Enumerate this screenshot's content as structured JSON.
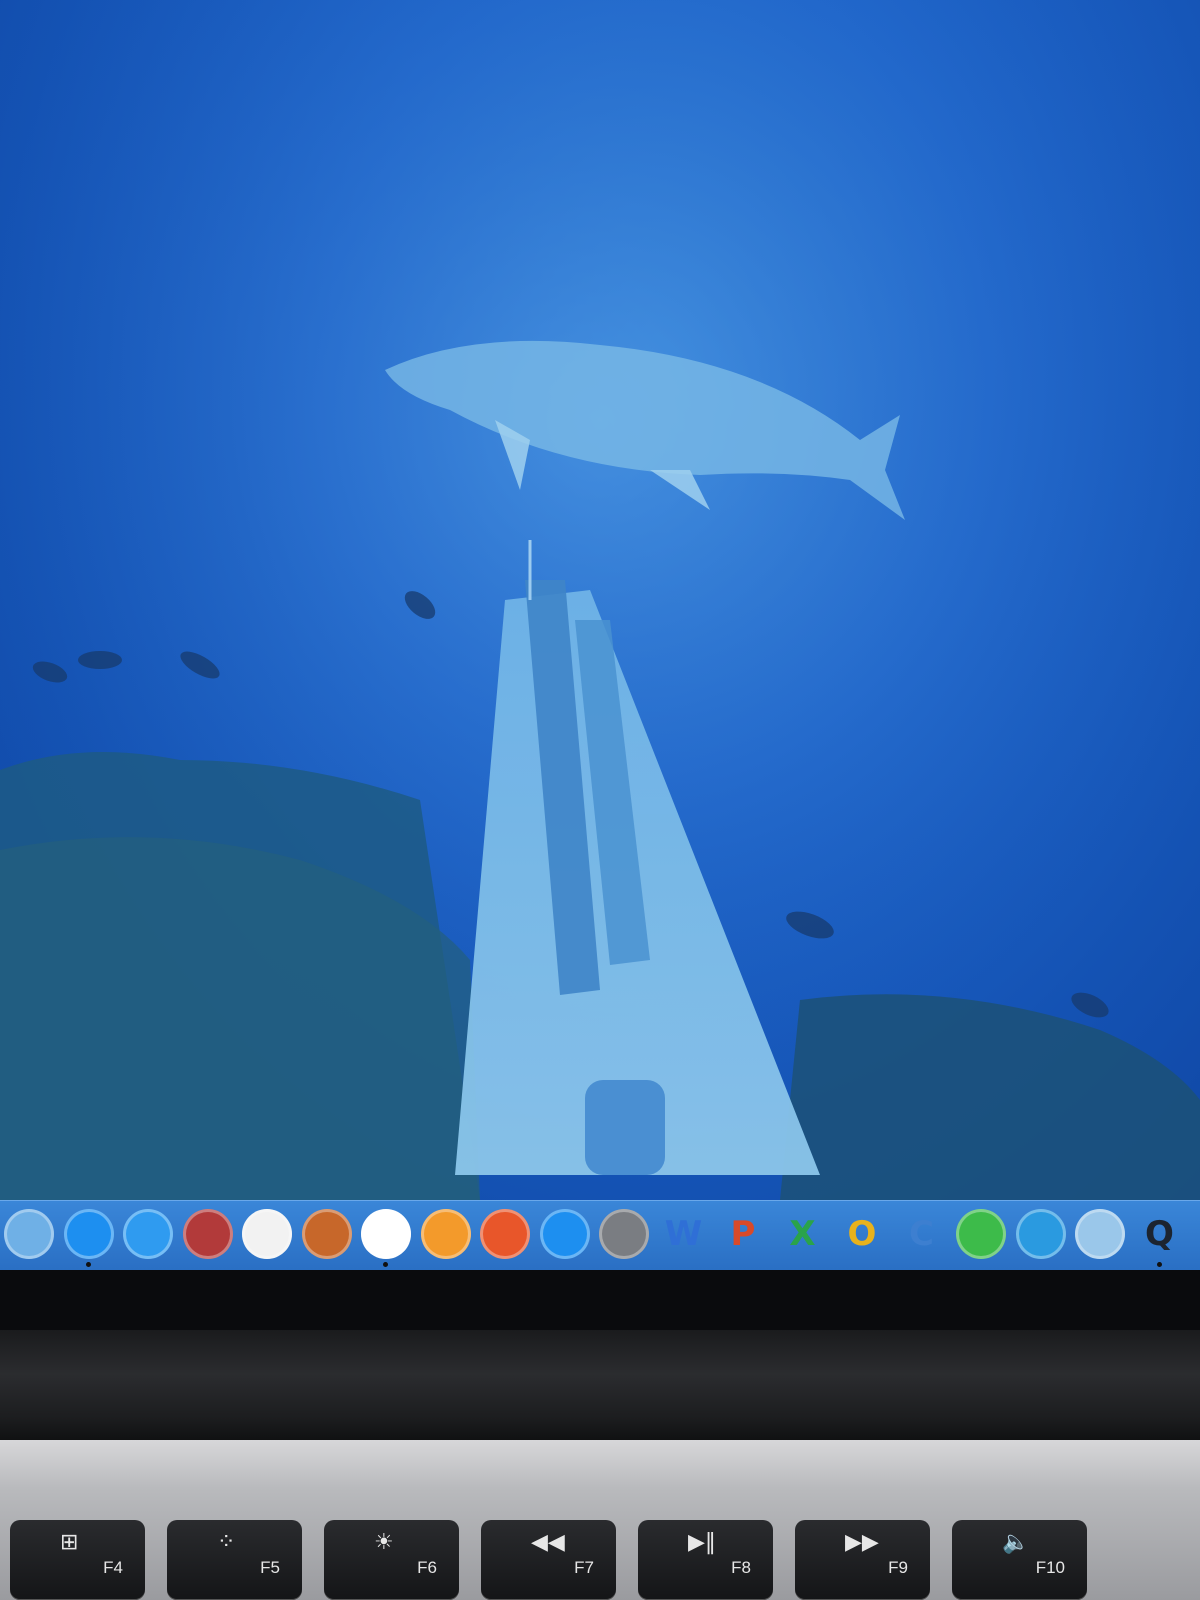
{
  "desktop": {
    "wallpaper_description_icon": "underwater-wallpaper-icon"
  },
  "dock": {
    "items": [
      {
        "name": "preview-app-icon",
        "glyph": "",
        "color": "#6fb0e6",
        "running": false
      },
      {
        "name": "safari-app-icon",
        "glyph": "",
        "color": "#1d8ff0",
        "running": true
      },
      {
        "name": "messages-app-icon",
        "glyph": "",
        "color": "#2f9bf0",
        "running": false
      },
      {
        "name": "photo-booth-app-icon",
        "glyph": "",
        "color": "#b23a3a",
        "running": false
      },
      {
        "name": "itunes-app-icon",
        "glyph": "",
        "color": "#f2f2f2",
        "running": false
      },
      {
        "name": "game-app-icon",
        "glyph": "",
        "color": "#c7672a",
        "running": false
      },
      {
        "name": "photos-app-icon",
        "glyph": "",
        "color": "#ffffff",
        "running": true
      },
      {
        "name": "ibooks-app-icon",
        "glyph": "",
        "color": "#f39a2b",
        "running": false
      },
      {
        "name": "firefox-app-icon",
        "glyph": "",
        "color": "#e8562a",
        "running": false
      },
      {
        "name": "app-store-app-icon",
        "glyph": "",
        "color": "#1d8ff0",
        "running": false
      },
      {
        "name": "system-preferences-app-icon",
        "glyph": "",
        "color": "#7a7d82",
        "running": false
      },
      {
        "name": "word-app-icon",
        "glyph": "W",
        "color": "#2f6fd6",
        "running": false
      },
      {
        "name": "powerpoint-app-icon",
        "glyph": "P",
        "color": "#d84a2a",
        "running": false
      },
      {
        "name": "excel-app-icon",
        "glyph": "X",
        "color": "#2aa34a",
        "running": false
      },
      {
        "name": "outlook-app-icon",
        "glyph": "O",
        "color": "#e8b21c",
        "running": false
      },
      {
        "name": "communicator-app-icon",
        "glyph": "C",
        "color": "#3d7fd0",
        "running": false
      },
      {
        "name": "messenger-app-icon",
        "glyph": "",
        "color": "#3dbb4a",
        "running": false
      },
      {
        "name": "download-app-icon",
        "glyph": "",
        "color": "#2a9ae0",
        "running": false
      },
      {
        "name": "remote-desktop-app-icon",
        "glyph": "",
        "color": "#9ac7ea",
        "running": false
      },
      {
        "name": "quicktime-app-icon",
        "glyph": "Q",
        "color": "#1c2430",
        "running": true
      }
    ]
  },
  "keyboard": {
    "keys": [
      {
        "name": "key-f4",
        "symbol": "⊞",
        "label": "F4"
      },
      {
        "name": "key-f5",
        "symbol": "⁘",
        "label": "F5"
      },
      {
        "name": "key-f6",
        "symbol": "☀",
        "label": "F6"
      },
      {
        "name": "key-f7",
        "symbol": "◀◀",
        "label": "F7"
      },
      {
        "name": "key-f8",
        "symbol": "▶‖",
        "label": "F8"
      },
      {
        "name": "key-f9",
        "symbol": "▶▶",
        "label": "F9"
      },
      {
        "name": "key-f10",
        "symbol": "🔈",
        "label": "F10"
      }
    ]
  }
}
